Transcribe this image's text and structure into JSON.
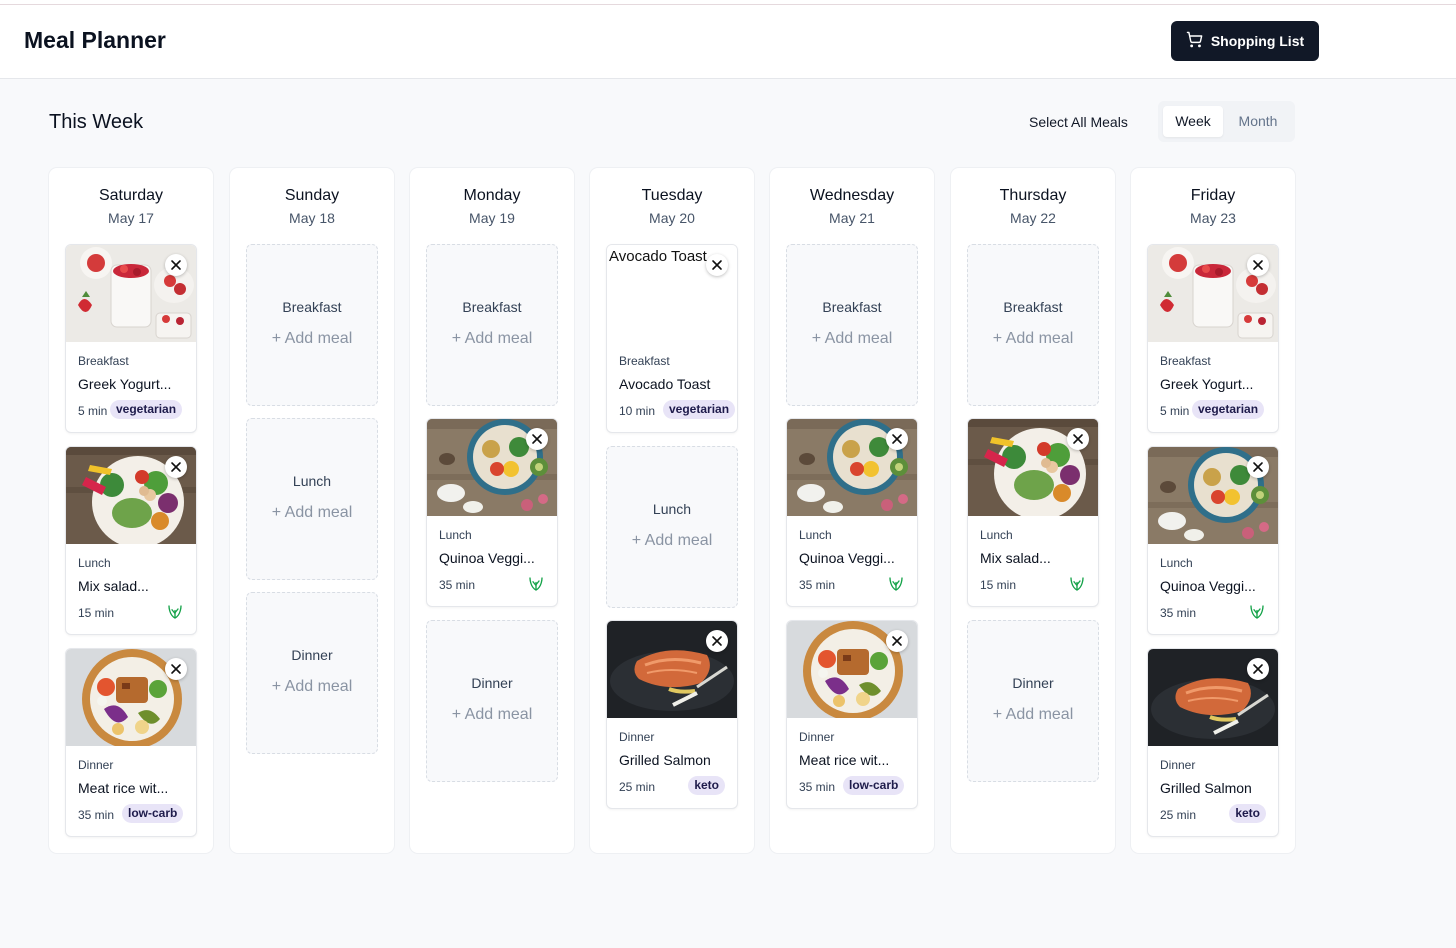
{
  "app": {
    "title": "Meal Planner",
    "shopping_label": "Shopping List"
  },
  "toolbar": {
    "heading": "This Week",
    "select_all": "Select All Meals",
    "view_week": "Week",
    "view_month": "Month"
  },
  "add_label": "+ Add meal",
  "icons": {
    "cart": "cart-icon",
    "close": "close-icon",
    "vegan": "vegan-leaf-icon",
    "plus": "plus-icon"
  },
  "colors": {
    "accent_dark": "#111827",
    "tag_bg": "#e8e4f7",
    "vegan_green": "#16a34a"
  },
  "days": [
    {
      "day": "Saturday",
      "date": "May 17",
      "slots": [
        {
          "type": "Breakfast",
          "meal": {
            "name": "Greek Yogurt...",
            "time": "5 min",
            "tag": "vegetarian",
            "image": "yogurt"
          }
        },
        {
          "type": "Lunch",
          "meal": {
            "name": "Mix salad...",
            "time": "15 min",
            "vegan": true,
            "image": "salad"
          }
        },
        {
          "type": "Dinner",
          "meal": {
            "name": "Meat rice wit...",
            "time": "35 min",
            "tag": "low-carb",
            "image": "rice"
          }
        }
      ]
    },
    {
      "day": "Sunday",
      "date": "May 18",
      "slots": [
        {
          "type": "Breakfast",
          "meal": null
        },
        {
          "type": "Lunch",
          "meal": null
        },
        {
          "type": "Dinner",
          "meal": null
        }
      ]
    },
    {
      "day": "Monday",
      "date": "May 19",
      "slots": [
        {
          "type": "Breakfast",
          "meal": null
        },
        {
          "type": "Lunch",
          "meal": {
            "name": "Quinoa Veggi...",
            "time": "35 min",
            "vegan": true,
            "image": "quinoa"
          }
        },
        {
          "type": "Dinner",
          "meal": null
        }
      ]
    },
    {
      "day": "Tuesday",
      "date": "May 20",
      "slots": [
        {
          "type": "Breakfast",
          "meal": {
            "name": "Avocado Toast",
            "time": "10 min",
            "tag": "vegetarian",
            "image": "broken",
            "alt": "Avocado Toast"
          }
        },
        {
          "type": "Lunch",
          "meal": null
        },
        {
          "type": "Dinner",
          "meal": {
            "name": "Grilled Salmon",
            "time": "25 min",
            "tag": "keto",
            "image": "salmon"
          }
        }
      ]
    },
    {
      "day": "Wednesday",
      "date": "May 21",
      "slots": [
        {
          "type": "Breakfast",
          "meal": null
        },
        {
          "type": "Lunch",
          "meal": {
            "name": "Quinoa Veggi...",
            "time": "35 min",
            "vegan": true,
            "image": "quinoa"
          }
        },
        {
          "type": "Dinner",
          "meal": {
            "name": "Meat rice wit...",
            "time": "35 min",
            "tag": "low-carb",
            "image": "rice"
          }
        }
      ]
    },
    {
      "day": "Thursday",
      "date": "May 22",
      "slots": [
        {
          "type": "Breakfast",
          "meal": null
        },
        {
          "type": "Lunch",
          "meal": {
            "name": "Mix salad...",
            "time": "15 min",
            "vegan": true,
            "image": "salad"
          }
        },
        {
          "type": "Dinner",
          "meal": null
        }
      ]
    },
    {
      "day": "Friday",
      "date": "May 23",
      "slots": [
        {
          "type": "Breakfast",
          "meal": {
            "name": "Greek Yogurt...",
            "time": "5 min",
            "tag": "vegetarian",
            "image": "yogurt"
          }
        },
        {
          "type": "Lunch",
          "meal": {
            "name": "Quinoa Veggi...",
            "time": "35 min",
            "vegan": true,
            "image": "quinoa"
          }
        },
        {
          "type": "Dinner",
          "meal": {
            "name": "Grilled Salmon",
            "time": "25 min",
            "tag": "keto",
            "image": "salmon"
          }
        }
      ]
    }
  ]
}
